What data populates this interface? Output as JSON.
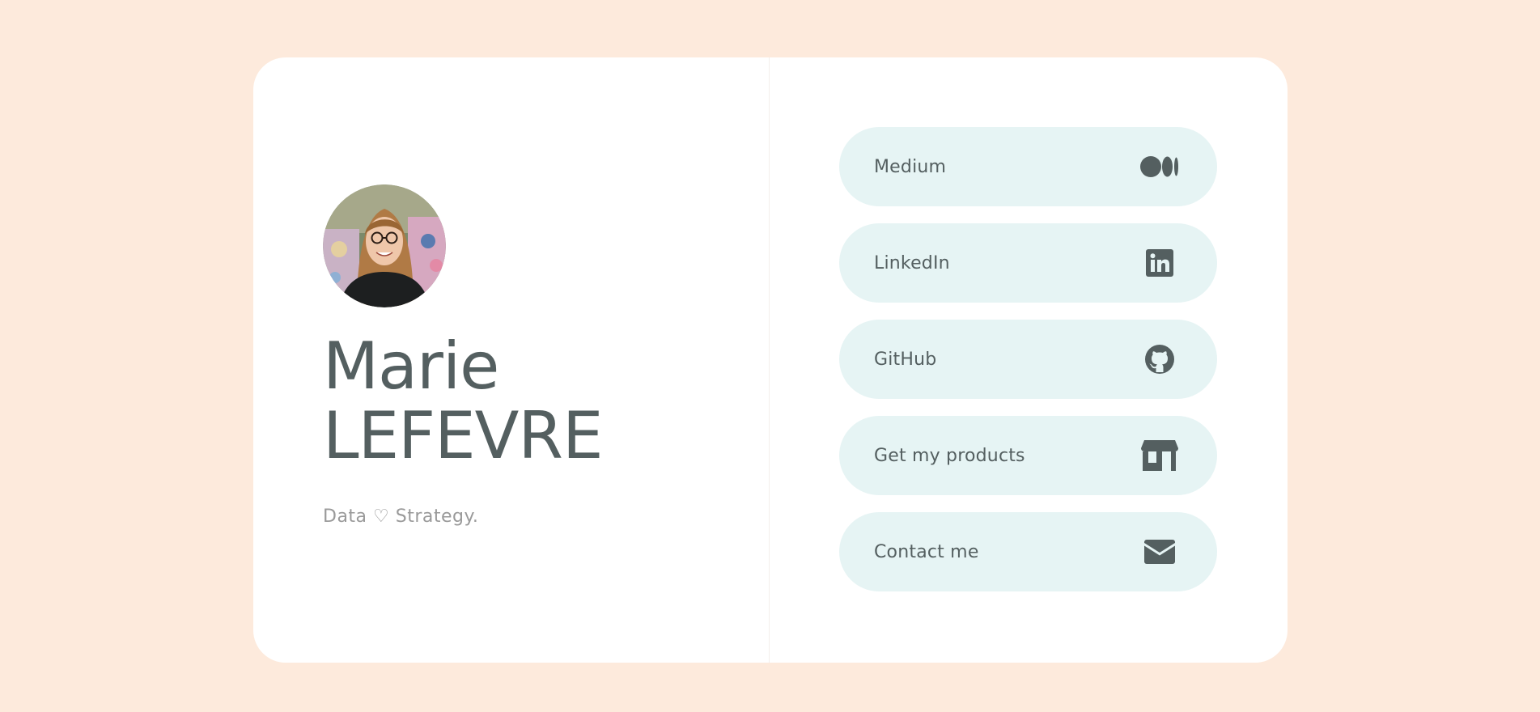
{
  "colors": {
    "page_background": "#fdeadc",
    "card_background": "#ffffff",
    "text_primary": "#545f60",
    "text_muted": "#9a9a9a",
    "button_background": "#e6f4f4",
    "icon_color": "#545f60"
  },
  "profile": {
    "avatar_alt": "Marie LEFEVRE",
    "first_name": "Marie",
    "last_name": "LEFEVRE",
    "tagline": "Data ♡ Strategy."
  },
  "links": [
    {
      "label": "Medium",
      "icon": "medium-icon"
    },
    {
      "label": "LinkedIn",
      "icon": "linkedin-icon"
    },
    {
      "label": "GitHub",
      "icon": "github-icon"
    },
    {
      "label": "Get my products",
      "icon": "shop-icon"
    },
    {
      "label": "Contact me",
      "icon": "envelope-icon"
    }
  ]
}
